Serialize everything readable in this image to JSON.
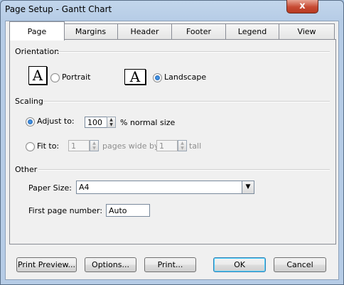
{
  "window": {
    "title": "Page Setup - Gantt Chart",
    "close_glyph": "x"
  },
  "tabs": [
    {
      "label": "Page",
      "active": true
    },
    {
      "label": "Margins"
    },
    {
      "label": "Header"
    },
    {
      "label": "Footer"
    },
    {
      "label": "Legend"
    },
    {
      "label": "View"
    }
  ],
  "orientation": {
    "heading": "Orientation",
    "glyph": "A",
    "portrait_label": "Portrait",
    "landscape_label": "Landscape",
    "selected": "landscape"
  },
  "scaling": {
    "heading": "Scaling",
    "adjust_label": "Adjust to:",
    "adjust_value": "100",
    "adjust_suffix": "% normal size",
    "fit_label": "Fit to:",
    "fit_wide_value": "1",
    "fit_wide_suffix": "pages wide by",
    "fit_tall_value": "1",
    "fit_tall_suffix": "tall",
    "selected": "adjust"
  },
  "other": {
    "heading": "Other",
    "paper_size_label": "Paper Size:",
    "paper_size_value": "A4",
    "first_page_label": "First page number:",
    "first_page_value": "Auto"
  },
  "buttons": {
    "print_preview": "Print Preview...",
    "options": "Options...",
    "print": "Print...",
    "ok": "OK",
    "cancel": "Cancel"
  }
}
